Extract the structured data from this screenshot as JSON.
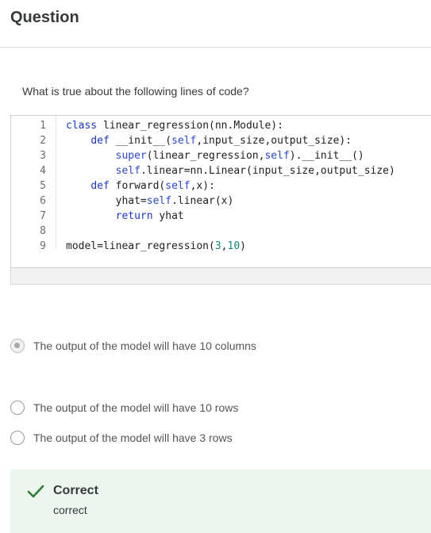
{
  "header": {
    "title": "Question"
  },
  "question": {
    "prompt": "What is true about the following lines of code?"
  },
  "code": {
    "line_numbers": [
      "1",
      "2",
      "3",
      "4",
      "5",
      "6",
      "7",
      "8",
      "9"
    ],
    "lines": [
      [
        {
          "t": "class",
          "k": "kw"
        },
        {
          "t": " linear_regression(nn.Module):",
          "k": "plain"
        }
      ],
      [
        {
          "t": "    ",
          "k": "plain"
        },
        {
          "t": "def",
          "k": "kw"
        },
        {
          "t": " __init__(",
          "k": "plain"
        },
        {
          "t": "self",
          "k": "bi"
        },
        {
          "t": ",input_size,output_size):",
          "k": "plain"
        }
      ],
      [
        {
          "t": "        ",
          "k": "plain"
        },
        {
          "t": "super",
          "k": "bi"
        },
        {
          "t": "(linear_regression,",
          "k": "plain"
        },
        {
          "t": "self",
          "k": "bi"
        },
        {
          "t": ").__init__()",
          "k": "plain"
        }
      ],
      [
        {
          "t": "        ",
          "k": "plain"
        },
        {
          "t": "self",
          "k": "bi"
        },
        {
          "t": ".linear=nn.Linear(input_size,output_size)",
          "k": "plain"
        }
      ],
      [
        {
          "t": "    ",
          "k": "plain"
        },
        {
          "t": "def",
          "k": "kw"
        },
        {
          "t": " forward(",
          "k": "plain"
        },
        {
          "t": "self",
          "k": "bi"
        },
        {
          "t": ",x):",
          "k": "plain"
        }
      ],
      [
        {
          "t": "        yhat=",
          "k": "plain"
        },
        {
          "t": "self",
          "k": "bi"
        },
        {
          "t": ".linear(x)",
          "k": "plain"
        }
      ],
      [
        {
          "t": "        ",
          "k": "plain"
        },
        {
          "t": "return",
          "k": "kw"
        },
        {
          "t": " yhat",
          "k": "plain"
        }
      ],
      [],
      [
        {
          "t": "model=linear_regression(",
          "k": "plain"
        },
        {
          "t": "3",
          "k": "num"
        },
        {
          "t": ",",
          "k": "plain"
        },
        {
          "t": "10",
          "k": "num"
        },
        {
          "t": ")",
          "k": "plain"
        }
      ]
    ]
  },
  "options": [
    {
      "label": "The output of the model will have 10 columns",
      "selected": true
    },
    {
      "label": "The output of the model will have 10 rows",
      "selected": false
    },
    {
      "label": "The output of the model will have 3 rows",
      "selected": false
    }
  ],
  "feedback": {
    "title": "Correct",
    "text": "correct",
    "icon": "checkmark-icon",
    "color": "#2e7d32"
  }
}
